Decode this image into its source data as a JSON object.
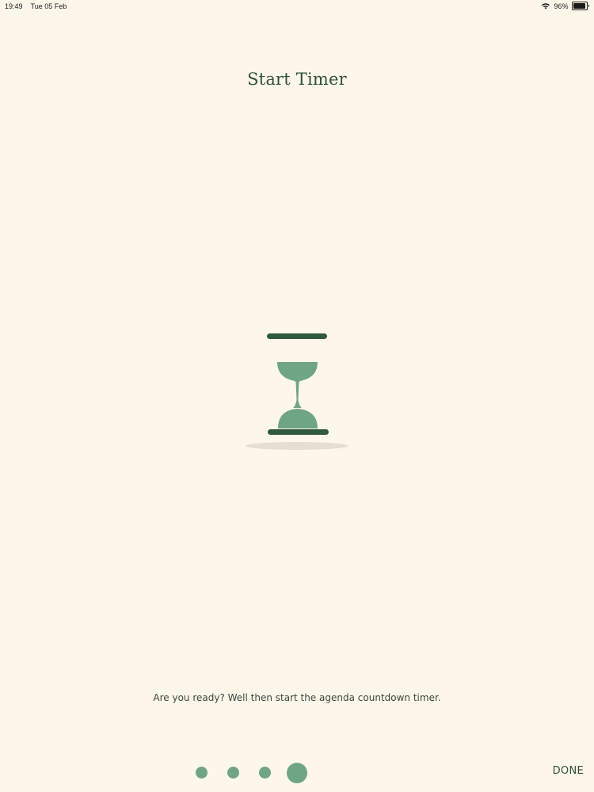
{
  "status_bar": {
    "time": "19:49",
    "date": "Tue 05 Feb",
    "battery_percent_label": "96%",
    "battery_level": 0.96
  },
  "title": "Start Timer",
  "description": "Are you ready? Well then start the agenda countdown timer.",
  "pager": {
    "total": 4,
    "active_index": 3
  },
  "done_label": "DONE",
  "colors": {
    "background": "#fdf7e9",
    "accent_green": "#6fa585",
    "dark_green": "#2f4f38"
  },
  "icons": [
    "wifi-icon",
    "battery-icon",
    "hourglass-icon"
  ]
}
